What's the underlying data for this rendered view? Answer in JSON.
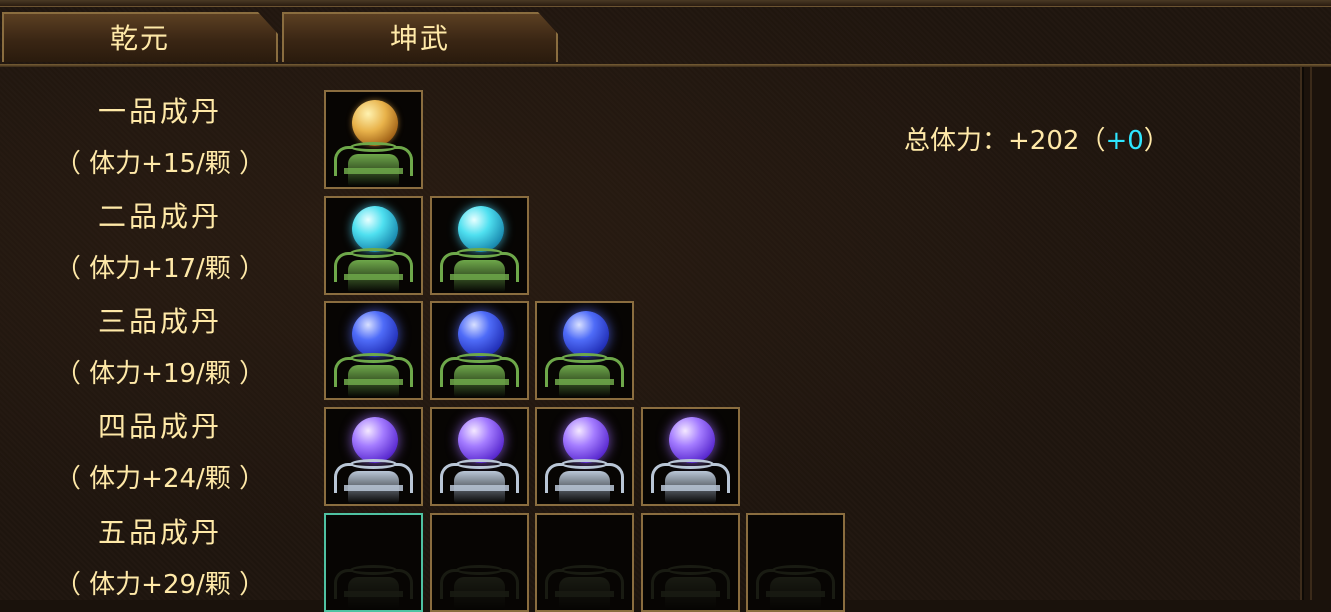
{
  "tabs": [
    {
      "label": "乾元"
    },
    {
      "label": "坤武"
    }
  ],
  "rows": [
    {
      "grade": "一品成丹",
      "bonus": "（ 体力+15/颗 ）"
    },
    {
      "grade": "二品成丹",
      "bonus": "（ 体力+17/颗 ）"
    },
    {
      "grade": "三品成丹",
      "bonus": "（ 体力+19/颗 ）"
    },
    {
      "grade": "四品成丹",
      "bonus": "（ 体力+24/颗 ）"
    },
    {
      "grade": "五品成丹",
      "bonus": "（ 体力+29/颗 ）"
    }
  ],
  "slots": {
    "row1": [
      "gold-orb"
    ],
    "row2": [
      "cyan-orb",
      "cyan-orb"
    ],
    "row3": [
      "blue-orb",
      "blue-orb",
      "blue-orb"
    ],
    "row4": [
      "purple-orb",
      "purple-orb",
      "purple-orb",
      "purple-orb"
    ],
    "row5": [
      "empty",
      "empty",
      "empty",
      "empty",
      "empty"
    ]
  },
  "total": {
    "label": "总体力：",
    "value": "+202",
    "open": "（",
    "extra": "+0",
    "close": "）"
  },
  "colors": {
    "text": "#ffe9a8",
    "extra": "#2ee6ff",
    "slot_border": "#8a6d3f",
    "selected_border": "#4fc2a2"
  }
}
